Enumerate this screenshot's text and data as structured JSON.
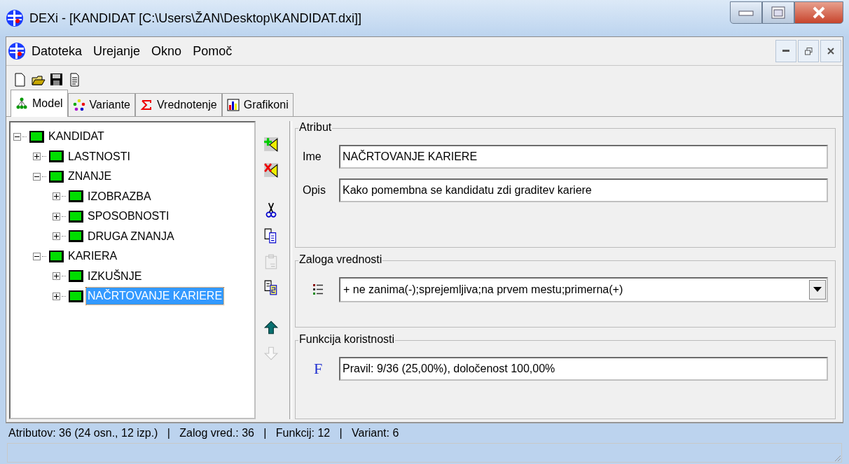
{
  "window": {
    "title": "DEXi - [KANDIDAT [C:\\Users\\ŽAN\\Desktop\\KANDIDAT.dxi]]"
  },
  "menu": [
    "Datoteka",
    "Urejanje",
    "Okno",
    "Pomoč"
  ],
  "toolbar": [
    {
      "kind": "new"
    },
    {
      "kind": "open"
    },
    {
      "kind": "save"
    },
    {
      "kind": "report"
    }
  ],
  "tabs": [
    {
      "label": "Model",
      "kind": "model",
      "selected": true
    },
    {
      "label": "Variante",
      "kind": "variants",
      "selected": false
    },
    {
      "label": "Vrednotenje",
      "kind": "sigma",
      "selected": false
    },
    {
      "label": "Grafikoni",
      "kind": "chart",
      "selected": false
    }
  ],
  "tree": {
    "label": "KANDIDAT",
    "expanded": true,
    "selected": false,
    "children": [
      {
        "label": "LASTNOSTI",
        "expanded": false,
        "selected": false
      },
      {
        "label": "ZNANJE",
        "expanded": true,
        "selected": false,
        "children": [
          {
            "label": "IZOBRAZBA",
            "expanded": false,
            "selected": false
          },
          {
            "label": "SPOSOBNOSTI",
            "expanded": false,
            "selected": false
          },
          {
            "label": "DRUGA ZNANJA",
            "expanded": false,
            "selected": false
          }
        ]
      },
      {
        "label": "KARIERA",
        "expanded": true,
        "selected": false,
        "children": [
          {
            "label": "IZKUŠNJE",
            "expanded": false,
            "selected": false
          },
          {
            "label": "NAČRTOVANJE KARIERE",
            "expanded": false,
            "selected": true
          }
        ]
      }
    ]
  },
  "side_buttons": [
    {
      "kind": "add",
      "disabled": false
    },
    {
      "kind": "delete",
      "disabled": false
    },
    {
      "kind": "cut",
      "disabled": false
    },
    {
      "kind": "copy",
      "disabled": false
    },
    {
      "kind": "paste",
      "disabled": true
    },
    {
      "kind": "duplicate",
      "disabled": false
    },
    {
      "kind": "up",
      "disabled": false
    },
    {
      "kind": "down",
      "disabled": true
    }
  ],
  "attribute": {
    "title": "Atribut",
    "name_label": "Ime",
    "name_value": "NAČRTOVANJE KARIERE",
    "description_label": "Opis",
    "description_value": "Kako pomembna se kandidatu zdi graditev kariere"
  },
  "scale": {
    "title": "Zaloga vrednosti",
    "value": "+ ne zanima(-);sprejemljiva;na prvem mestu;primerna(+)"
  },
  "function": {
    "title": "Funkcija koristnosti",
    "icon_text": "F",
    "value": "Pravil: 9/36 (25,00%), določenost 100,00%"
  },
  "status_bar": {
    "text": "Atributov: 36 (24 osn., 12 izp.)   |   Zalog vred.: 36   |   Funkcij: 12   |   Variant: 6"
  }
}
